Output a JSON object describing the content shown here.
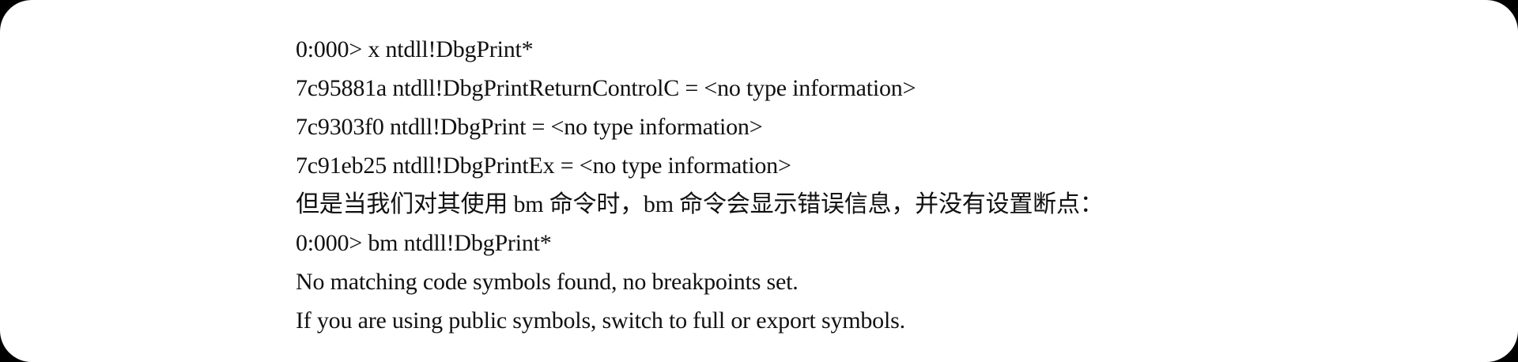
{
  "document": {
    "lines": [
      "0:000> x ntdll!DbgPrint*",
      "7c95881a ntdll!DbgPrintReturnControlC = <no type information>",
      "7c9303f0 ntdll!DbgPrint = <no type information>",
      "7c91eb25 ntdll!DbgPrintEx = <no type information>",
      "但是当我们对其使用 bm 命令时，bm 命令会显示错误信息，并没有设置断点：",
      "0:000> bm ntdll!DbgPrint*",
      "No matching code symbols found, no breakpoints set.",
      "If you are using public symbols, switch to full or export symbols."
    ]
  }
}
